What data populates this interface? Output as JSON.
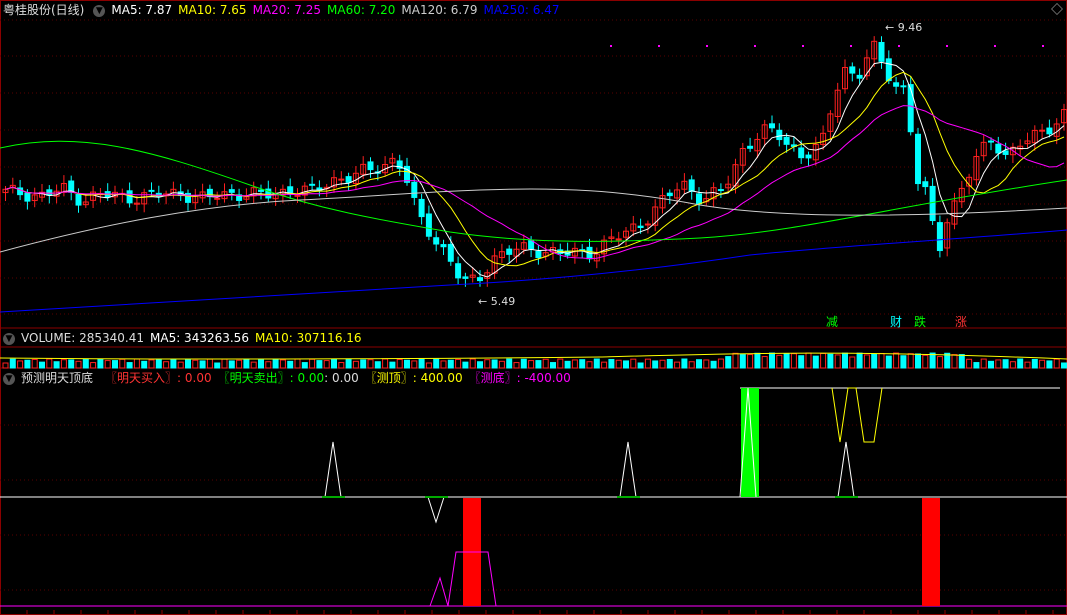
{
  "header": {
    "stock_name": "粤桂股份(日线)",
    "ma_items": [
      {
        "label": "MA5: 7.87",
        "color": "#ffffff"
      },
      {
        "label": "MA10: 7.65",
        "color": "#ffff00"
      },
      {
        "label": "MA20: 7.25",
        "color": "#ff00ff"
      },
      {
        "label": "MA60: 7.20",
        "color": "#00ff00"
      },
      {
        "label": "MA120: 6.79",
        "color": "#cccccc"
      },
      {
        "label": "MA250: 6.47",
        "color": "#0000ff"
      }
    ]
  },
  "volume_header": {
    "title": "VOLUME: 285340.41",
    "ma5": "MA5: 343263.56",
    "ma10": "MA10: 307116.16"
  },
  "indicator_header": {
    "title": "预测明天顶底",
    "buy": "〖明天买入〗: 0.00",
    "sell": "〖明天卖出〗: 0.00",
    "extra": ": 0.00",
    "top": "〖测顶〗: 400.00",
    "bottom": "〖测底〗: -400.00"
  },
  "price_annotations": {
    "high": "9.46",
    "low": "5.49"
  },
  "signals": [
    {
      "text": "减",
      "color": "#00ff00"
    },
    {
      "text": "财",
      "color": "#00ffff"
    },
    {
      "text": "跌",
      "color": "#00ff00"
    },
    {
      "text": "涨",
      "color": "#ff3333"
    }
  ],
  "colors": {
    "up": "#ff2020",
    "down": "#00ffff",
    "grid": "#8b0000",
    "ma5": "#ffffff",
    "ma10": "#ffff00",
    "ma20": "#ff00ff",
    "ma60": "#00ff00",
    "ma120": "#cccccc",
    "ma250": "#0000ff"
  }
}
